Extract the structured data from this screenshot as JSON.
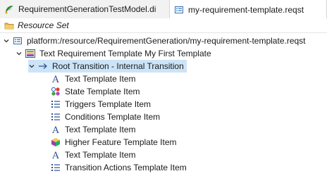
{
  "tabs": [
    {
      "label": "RequirementGenerationTestModel.di",
      "icon": "sirius-diagram-icon",
      "active": false
    },
    {
      "label": "my-requirement-template.reqst",
      "icon": "reqst-file-icon",
      "active": true
    }
  ],
  "toolbar": {
    "resource_set_label": "Resource Set"
  },
  "tree": {
    "root_resource": {
      "label": "platform:/resource/RequirementGeneration/my-requirement-template.reqst",
      "icon": "resource-file-icon"
    },
    "template": {
      "label": "Text Requirement Template My First Template",
      "icon": "template-icon"
    },
    "transition": {
      "label": "Root Transition - Internal Transition",
      "icon": "arrow-right-icon"
    },
    "items": [
      {
        "label": "Text Template Item",
        "icon": "text-item-icon"
      },
      {
        "label": "State Template Item",
        "icon": "state-item-icon"
      },
      {
        "label": "Triggers Template Item",
        "icon": "list-item-icon"
      },
      {
        "label": "Conditions Template Item",
        "icon": "list-item-icon"
      },
      {
        "label": "Text Template Item",
        "icon": "text-item-icon"
      },
      {
        "label": "Higher Feature Template Item",
        "icon": "feature-item-icon"
      },
      {
        "label": "Text Template Item",
        "icon": "text-item-icon"
      },
      {
        "label": "Transition Actions Template Item",
        "icon": "list-item-icon"
      }
    ]
  },
  "colors": {
    "selection": "#cce4f7",
    "tab_bar": "#f2f2f2"
  }
}
